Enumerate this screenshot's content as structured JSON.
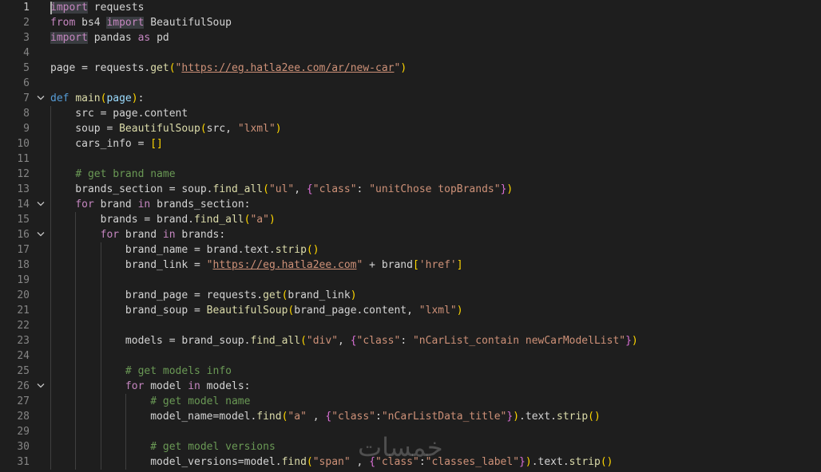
{
  "editor": {
    "language": "python",
    "active_line": 1,
    "watermark": "خمسات",
    "colors": {
      "background": "#1e1e1e",
      "line_number": "#858585",
      "keyword": "#c586c0",
      "storage": "#569cd6",
      "function": "#dcdcaa",
      "string": "#ce9178",
      "comment": "#6a9955",
      "parameter": "#9cdcfe",
      "bracket_1": "#ffd700",
      "bracket_2": "#da70d6",
      "bracket_3": "#179fff"
    },
    "lines": [
      {
        "n": "1",
        "fold": false,
        "tokens": [
          [
            "import",
            "kw hl"
          ],
          [
            " requests",
            ""
          ]
        ]
      },
      {
        "n": "2",
        "fold": false,
        "tokens": [
          [
            "from",
            "kw"
          ],
          [
            " bs4 ",
            ""
          ],
          [
            "import",
            "kw hl"
          ],
          [
            " BeautifulSoup",
            ""
          ]
        ]
      },
      {
        "n": "3",
        "fold": false,
        "tokens": [
          [
            "import",
            "kw hl"
          ],
          [
            " pandas ",
            ""
          ],
          [
            "as",
            "kw"
          ],
          [
            " pd",
            ""
          ]
        ]
      },
      {
        "n": "4",
        "fold": false,
        "tokens": []
      },
      {
        "n": "5",
        "fold": false,
        "tokens": [
          [
            "page = requests.",
            ""
          ],
          [
            "get",
            "fn"
          ],
          [
            "(",
            "b1"
          ],
          [
            "\"",
            "str"
          ],
          [
            "https://eg.hatla2ee.com/ar/new-car",
            "url"
          ],
          [
            "\"",
            "str"
          ],
          [
            ")",
            "b1"
          ]
        ]
      },
      {
        "n": "6",
        "fold": false,
        "tokens": []
      },
      {
        "n": "7",
        "fold": true,
        "tokens": [
          [
            "def",
            "kwd"
          ],
          [
            " ",
            ""
          ],
          [
            "main",
            "fn"
          ],
          [
            "(",
            "b1"
          ],
          [
            "page",
            "prm"
          ],
          [
            ")",
            "b1"
          ],
          [
            ":",
            ""
          ]
        ]
      },
      {
        "n": "8",
        "fold": false,
        "tokens": [
          [
            "    src = page.content",
            ""
          ]
        ]
      },
      {
        "n": "9",
        "fold": false,
        "tokens": [
          [
            "    soup = ",
            ""
          ],
          [
            "BeautifulSoup",
            "fn"
          ],
          [
            "(",
            "b1"
          ],
          [
            "src, ",
            ""
          ],
          [
            "\"lxml\"",
            "str"
          ],
          [
            ")",
            "b1"
          ]
        ]
      },
      {
        "n": "10",
        "fold": false,
        "tokens": [
          [
            "    cars_info = ",
            ""
          ],
          [
            "[]",
            "b1"
          ]
        ]
      },
      {
        "n": "11",
        "fold": false,
        "tokens": []
      },
      {
        "n": "12",
        "fold": false,
        "tokens": [
          [
            "    ",
            ""
          ],
          [
            "# get brand name",
            "cm"
          ]
        ]
      },
      {
        "n": "13",
        "fold": false,
        "tokens": [
          [
            "    brands_section = soup.",
            ""
          ],
          [
            "find_all",
            "fn"
          ],
          [
            "(",
            "b1"
          ],
          [
            "\"ul\"",
            "str"
          ],
          [
            ", ",
            ""
          ],
          [
            "{",
            "b2"
          ],
          [
            "\"class\"",
            "str"
          ],
          [
            ": ",
            ""
          ],
          [
            "\"unitChose topBrands\"",
            "str"
          ],
          [
            "}",
            "b2"
          ],
          [
            ")",
            "b1"
          ]
        ]
      },
      {
        "n": "14",
        "fold": true,
        "tokens": [
          [
            "    ",
            ""
          ],
          [
            "for",
            "kw"
          ],
          [
            " brand ",
            ""
          ],
          [
            "in",
            "kw"
          ],
          [
            " brands_section:",
            ""
          ]
        ]
      },
      {
        "n": "15",
        "fold": false,
        "tokens": [
          [
            "        brands = brand.",
            ""
          ],
          [
            "find_all",
            "fn"
          ],
          [
            "(",
            "b1"
          ],
          [
            "\"a\"",
            "str"
          ],
          [
            ")",
            "b1"
          ]
        ]
      },
      {
        "n": "16",
        "fold": true,
        "tokens": [
          [
            "        ",
            ""
          ],
          [
            "for",
            "kw"
          ],
          [
            " brand ",
            ""
          ],
          [
            "in",
            "kw"
          ],
          [
            " brands:",
            ""
          ]
        ]
      },
      {
        "n": "17",
        "fold": false,
        "tokens": [
          [
            "            brand_name = brand.text.",
            ""
          ],
          [
            "strip",
            "fn"
          ],
          [
            "()",
            "b1"
          ]
        ]
      },
      {
        "n": "18",
        "fold": false,
        "tokens": [
          [
            "            brand_link = ",
            ""
          ],
          [
            "\"",
            "str"
          ],
          [
            "https://eg.hatla2ee.com",
            "url"
          ],
          [
            "\"",
            "str"
          ],
          [
            " + brand",
            ""
          ],
          [
            "[",
            "b1"
          ],
          [
            "'href'",
            "str"
          ],
          [
            "]",
            "b1"
          ]
        ]
      },
      {
        "n": "19",
        "fold": false,
        "tokens": []
      },
      {
        "n": "20",
        "fold": false,
        "tokens": [
          [
            "            brand_page = requests.",
            ""
          ],
          [
            "get",
            "fn"
          ],
          [
            "(",
            "b1"
          ],
          [
            "brand_link",
            ""
          ],
          [
            ")",
            "b1"
          ]
        ]
      },
      {
        "n": "21",
        "fold": false,
        "tokens": [
          [
            "            brand_soup = ",
            ""
          ],
          [
            "BeautifulSoup",
            "fn"
          ],
          [
            "(",
            "b1"
          ],
          [
            "brand_page.content, ",
            ""
          ],
          [
            "\"lxml\"",
            "str"
          ],
          [
            ")",
            "b1"
          ]
        ]
      },
      {
        "n": "22",
        "fold": false,
        "tokens": []
      },
      {
        "n": "23",
        "fold": false,
        "tokens": [
          [
            "            models = brand_soup.",
            ""
          ],
          [
            "find_all",
            "fn"
          ],
          [
            "(",
            "b1"
          ],
          [
            "\"div\"",
            "str"
          ],
          [
            ", ",
            ""
          ],
          [
            "{",
            "b2"
          ],
          [
            "\"class\"",
            "str"
          ],
          [
            ": ",
            ""
          ],
          [
            "\"nCarList_contain newCarModelList\"",
            "str"
          ],
          [
            "}",
            "b2"
          ],
          [
            ")",
            "b1"
          ]
        ]
      },
      {
        "n": "24",
        "fold": false,
        "tokens": []
      },
      {
        "n": "25",
        "fold": false,
        "tokens": [
          [
            "            ",
            ""
          ],
          [
            "# get models info",
            "cm"
          ]
        ]
      },
      {
        "n": "26",
        "fold": true,
        "tokens": [
          [
            "            ",
            ""
          ],
          [
            "for",
            "kw"
          ],
          [
            " model ",
            ""
          ],
          [
            "in",
            "kw"
          ],
          [
            " models:",
            ""
          ]
        ]
      },
      {
        "n": "27",
        "fold": false,
        "tokens": [
          [
            "                ",
            ""
          ],
          [
            "# get model name",
            "cm"
          ]
        ]
      },
      {
        "n": "28",
        "fold": false,
        "tokens": [
          [
            "                model_name=model.",
            ""
          ],
          [
            "find",
            "fn"
          ],
          [
            "(",
            "b1"
          ],
          [
            "\"a\"",
            "str"
          ],
          [
            " , ",
            ""
          ],
          [
            "{",
            "b2"
          ],
          [
            "\"class\"",
            "str"
          ],
          [
            ":",
            ""
          ],
          [
            "\"nCarListData_title\"",
            "str"
          ],
          [
            "}",
            "b2"
          ],
          [
            ")",
            "b1"
          ],
          [
            ".text.",
            ""
          ],
          [
            "strip",
            "fn"
          ],
          [
            "()",
            "b1"
          ]
        ]
      },
      {
        "n": "29",
        "fold": false,
        "tokens": []
      },
      {
        "n": "30",
        "fold": false,
        "tokens": [
          [
            "                ",
            ""
          ],
          [
            "# get model versions",
            "cm"
          ]
        ]
      },
      {
        "n": "31",
        "fold": false,
        "tokens": [
          [
            "                model_versions=model.",
            ""
          ],
          [
            "find",
            "fn"
          ],
          [
            "(",
            "b1"
          ],
          [
            "\"span\"",
            "str"
          ],
          [
            " , ",
            ""
          ],
          [
            "{",
            "b2"
          ],
          [
            "\"class\"",
            "str"
          ],
          [
            ":",
            ""
          ],
          [
            "\"classes_label\"",
            "str"
          ],
          [
            "}",
            "b2"
          ],
          [
            ")",
            "b1"
          ],
          [
            ".text.",
            ""
          ],
          [
            "strip",
            "fn"
          ],
          [
            "()",
            "b1"
          ]
        ]
      }
    ]
  }
}
